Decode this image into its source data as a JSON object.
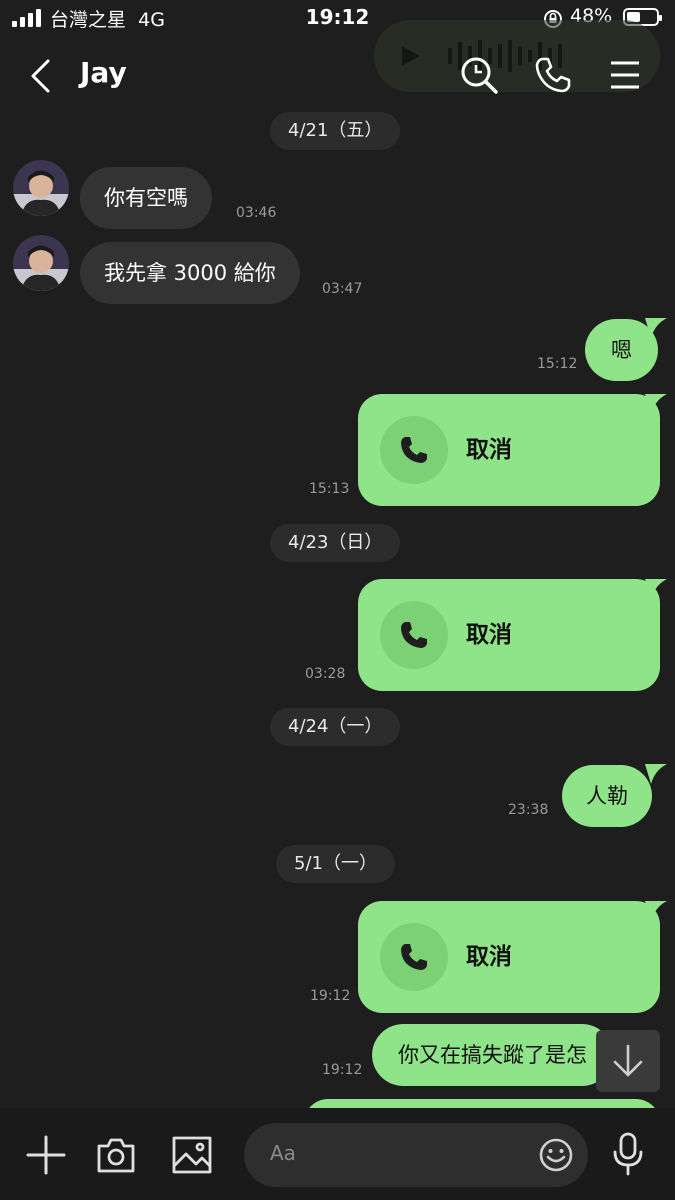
{
  "status": {
    "carrier": "台灣之星",
    "network": "4G",
    "time": "19:12",
    "battery": "48%",
    "battery_level": 0.48
  },
  "header": {
    "back_icon": "chevron-left-icon",
    "title": "Jay",
    "search_icon": "search-icon",
    "call_icon": "phone-icon",
    "menu_icon": "menu-icon"
  },
  "messages": {
    "d1": "4/21（五）",
    "m1_text": "你有空嗎",
    "m1_time": "03:46",
    "m2_text": "我先拿 3000 給你",
    "m2_time": "03:47",
    "m3_text": "嗯",
    "m3_time": "15:12",
    "c1_label": "取消",
    "c1_time": "15:13",
    "d2": "4/23（日）",
    "c2_label": "取消",
    "c2_time": "03:28",
    "d3": "4/24（一）",
    "m4_text": "人勒",
    "m4_time": "23:38",
    "d4": "5/1（一）",
    "c3_label": "取消",
    "c3_time": "19:12",
    "m5_text": "你又在搞失蹤了是怎",
    "m5_time": "19:12"
  },
  "composer": {
    "placeholder": "Aa",
    "icons": [
      "plus-icon",
      "camera-icon",
      "image-icon",
      "emoji-icon",
      "microphone-icon"
    ]
  },
  "colors": {
    "background": "#1e1e1e",
    "outgoing": "#8fe388",
    "incoming": "#333333"
  }
}
